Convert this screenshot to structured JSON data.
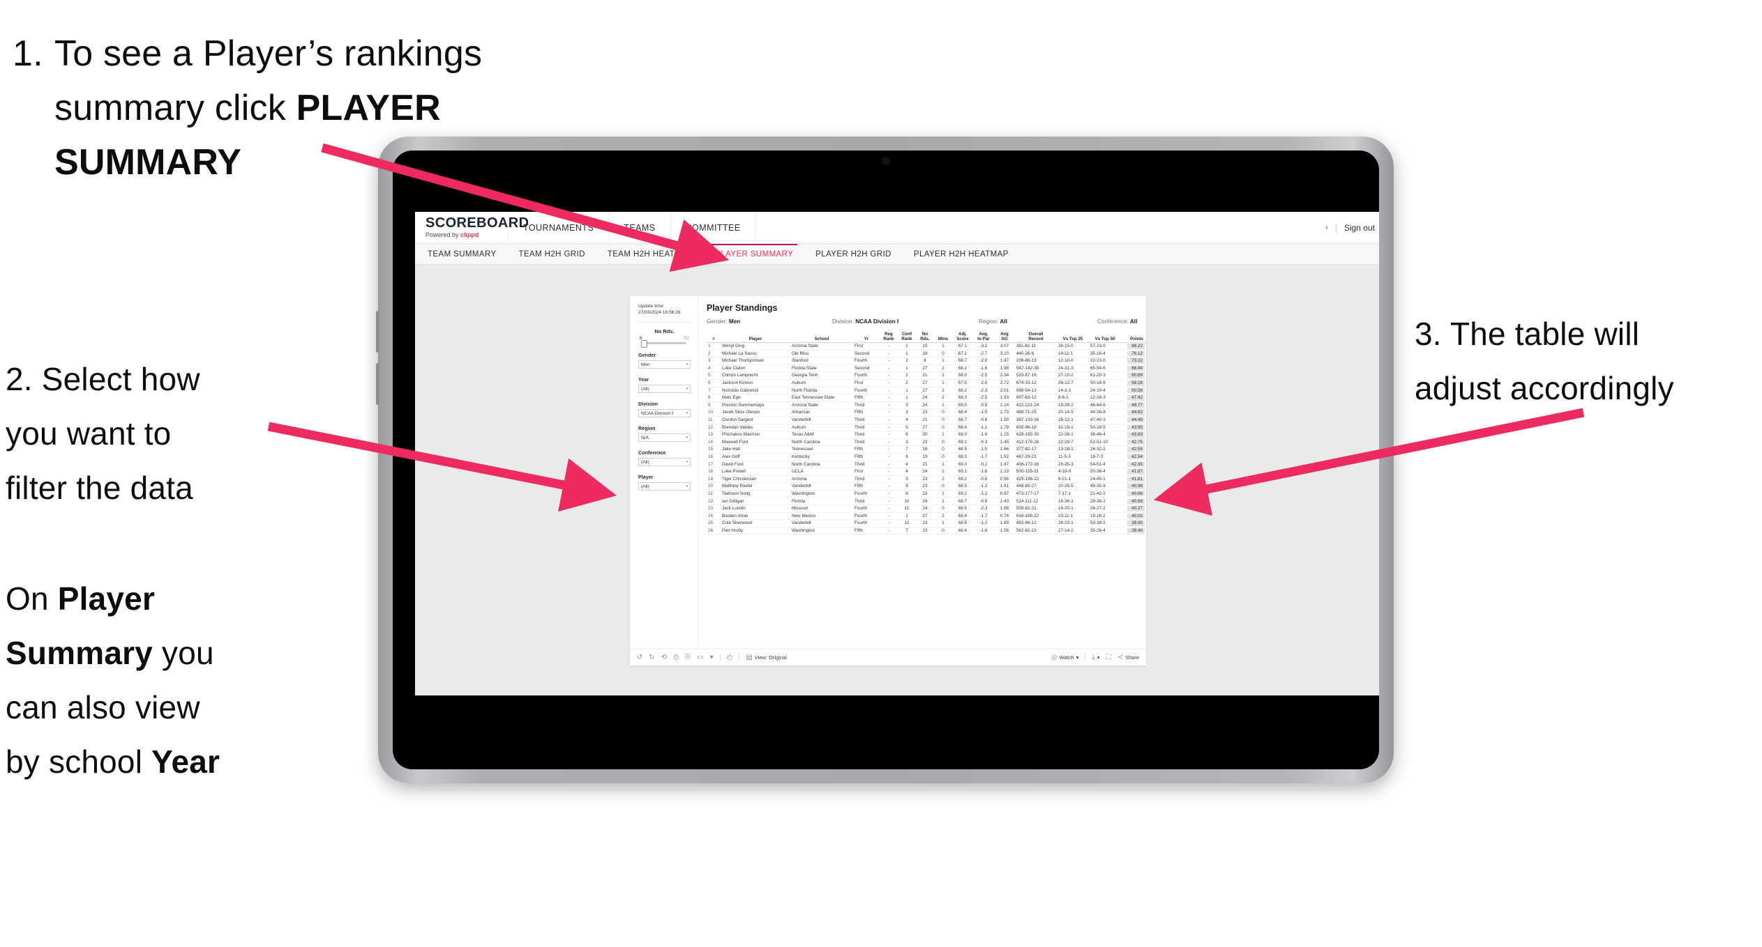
{
  "annotations": {
    "step1": {
      "num": "1.",
      "line1": "To see a Player’s rankings",
      "line2_pre": "summary click ",
      "line2_bold": "PLAYER",
      "line3_bold": "SUMMARY"
    },
    "step2": {
      "line1": "2. Select how",
      "line2": "you want to",
      "line3": "filter the data"
    },
    "step2b": {
      "l1_pre": "On ",
      "l1_bold": "Player",
      "l2_bold": "Summary",
      "l2_post": " you",
      "l3": "can also view",
      "l4_pre": "by school ",
      "l4_bold": "Year"
    },
    "step3": {
      "line1": "3. The table will",
      "line2": "adjust accordingly"
    }
  },
  "colors": {
    "accent": "#f2365b",
    "tab_underline": "#c2185b",
    "points_highlight": "#e2e2e2"
  },
  "app": {
    "logo": {
      "word": "SCOREBOARD",
      "powered_pre": "Powered by ",
      "powered_brand": "clippd"
    },
    "topnav": [
      "TOURNAMENTS",
      "TEAMS",
      "COMMITTEE"
    ],
    "account": {
      "chevron": "›",
      "divider": "|",
      "signout": "Sign out"
    },
    "tabs": [
      {
        "label": "TEAM SUMMARY",
        "active": false
      },
      {
        "label": "TEAM H2H GRID",
        "active": false
      },
      {
        "label": "TEAM H2H HEATMAP",
        "active": false
      },
      {
        "label": "PLAYER SUMMARY",
        "active": true
      },
      {
        "label": "PLAYER H2H GRID",
        "active": false
      },
      {
        "label": "PLAYER H2H HEATMAP",
        "active": false
      }
    ],
    "filters": {
      "update_label": "Update time:",
      "update_value": "27/03/2024 16:56:26",
      "slider": {
        "title": "No Rds.",
        "min": "6",
        "max": "52"
      },
      "selects": [
        {
          "label": "Gender",
          "value": "Men"
        },
        {
          "label": "Year",
          "value": "(All)"
        },
        {
          "label": "Division",
          "value": "NCAA Division I"
        },
        {
          "label": "Region",
          "value": "N/A"
        },
        {
          "label": "Conference",
          "value": "(All)"
        },
        {
          "label": "Player",
          "value": "(All)"
        }
      ]
    },
    "viz": {
      "title": "Player Standings",
      "subtitle": [
        {
          "label": "Gender:",
          "value": "Men"
        },
        {
          "label": "Division:",
          "value": "NCAA Division I"
        },
        {
          "label": "Region:",
          "value": "All"
        },
        {
          "label": "Conference:",
          "value": "All"
        }
      ],
      "columns": [
        {
          "key": "rank",
          "l1": "#",
          "l2": ""
        },
        {
          "key": "player",
          "l1": "Player",
          "l2": ""
        },
        {
          "key": "school",
          "l1": "School",
          "l2": ""
        },
        {
          "key": "yr",
          "l1": "Yr",
          "l2": ""
        },
        {
          "key": "reg",
          "l1": "Reg",
          "l2": "Rank"
        },
        {
          "key": "conf",
          "l1": "Conf",
          "l2": "Rank"
        },
        {
          "key": "nords",
          "l1": "No",
          "l2": "Rds."
        },
        {
          "key": "wins",
          "l1": "Wins",
          "l2": ""
        },
        {
          "key": "adj",
          "l1": "Adj.",
          "l2": "Score"
        },
        {
          "key": "avgpar",
          "l1": "Avg.",
          "l2": "to Par"
        },
        {
          "key": "sg",
          "l1": "Avg",
          "l2": "SG"
        },
        {
          "key": "record",
          "l1": "Overall",
          "l2": "Record"
        },
        {
          "key": "vs25",
          "l1": "Vs Top 25",
          "l2": ""
        },
        {
          "key": "vs50",
          "l1": "Vs Top 50",
          "l2": ""
        },
        {
          "key": "points",
          "l1": "Points",
          "l2": ""
        }
      ],
      "rows": [
        {
          "rank": "1",
          "player": "Wenyi Ding",
          "school": "Arizona State",
          "yr": "First",
          "reg": "-",
          "conf": "1",
          "nords": "15",
          "wins": "1",
          "adj": "67.1",
          "avgpar": "-3.2",
          "sg": "3.07",
          "record": "381-61-11",
          "vs25": "28-15-0",
          "vs50": "57-23-0",
          "points": "88.22"
        },
        {
          "rank": "2",
          "player": "Michael La Sasso",
          "school": "Ole Miss",
          "yr": "Second",
          "reg": "-",
          "conf": "1",
          "nords": "18",
          "wins": "0",
          "adj": "67.1",
          "avgpar": "-2.7",
          "sg": "3.10",
          "record": "440-26-6",
          "vs25": "19-11-1",
          "vs50": "35-16-4",
          "points": "76.12"
        },
        {
          "rank": "3",
          "player": "Michael Thorbjornsen",
          "school": "Stanford",
          "yr": "Fourth",
          "reg": "-",
          "conf": "2",
          "nords": "9",
          "wins": "1",
          "adj": "68.7",
          "avgpar": "-2.0",
          "sg": "1.47",
          "record": "208-86-13",
          "vs25": "12-10-0",
          "vs50": "22-22-0",
          "points": "73.22"
        },
        {
          "rank": "4",
          "player": "Luke Claton",
          "school": "Florida State",
          "yr": "Second",
          "reg": "-",
          "conf": "1",
          "nords": "27",
          "wins": "2",
          "adj": "68.2",
          "avgpar": "-1.6",
          "sg": "1.98",
          "record": "547-142-38",
          "vs25": "24-31-3",
          "vs50": "65-54-6",
          "points": "66.94"
        },
        {
          "rank": "5",
          "player": "Christo Lamprecht",
          "school": "Georgia Tech",
          "yr": "Fourth",
          "reg": "-",
          "conf": "2",
          "nords": "21",
          "wins": "2",
          "adj": "68.0",
          "avgpar": "-2.5",
          "sg": "2.34",
          "record": "533-57-16",
          "vs25": "27-10-2",
          "vs50": "61-20-3",
          "points": "60.89"
        },
        {
          "rank": "6",
          "player": "Jackson Koivun",
          "school": "Auburn",
          "yr": "First",
          "reg": "-",
          "conf": "2",
          "nords": "27",
          "wins": "1",
          "adj": "67.5",
          "avgpar": "-2.0",
          "sg": "2.72",
          "record": "674-33-12",
          "vs25": "28-12-7",
          "vs50": "50-16-8",
          "points": "58.18"
        },
        {
          "rank": "7",
          "player": "Nicholas Gabrelcik",
          "school": "North Florida",
          "yr": "Fourth",
          "reg": "-",
          "conf": "1",
          "nords": "27",
          "wins": "2",
          "adj": "68.2",
          "avgpar": "-2.3",
          "sg": "2.01",
          "record": "698-54-13",
          "vs25": "14-3-3",
          "vs50": "24-10-4",
          "points": "50.56"
        },
        {
          "rank": "8",
          "player": "Mats Ege",
          "school": "East Tennessee State",
          "yr": "Fifth",
          "reg": "-",
          "conf": "1",
          "nords": "24",
          "wins": "2",
          "adj": "68.3",
          "avgpar": "-2.5",
          "sg": "1.93",
          "record": "607-63-12",
          "vs25": "8-6-1",
          "vs50": "12-16-3",
          "points": "47.42"
        },
        {
          "rank": "9",
          "player": "Preston Summerhays",
          "school": "Arizona State",
          "yr": "Third",
          "reg": "-",
          "conf": "3",
          "nords": "24",
          "wins": "1",
          "adj": "69.0",
          "avgpar": "-0.5",
          "sg": "1.14",
          "record": "412-221-24",
          "vs25": "19-39-2",
          "vs50": "46-64-6",
          "points": "46.77"
        },
        {
          "rank": "10",
          "player": "Jacob Skov Olesen",
          "school": "Arkansas",
          "yr": "Fifth",
          "reg": "-",
          "conf": "3",
          "nords": "23",
          "wins": "0",
          "adj": "68.4",
          "avgpar": "-1.5",
          "sg": "1.73",
          "record": "488-72-25",
          "vs25": "20-14-5",
          "vs50": "44-26-8",
          "points": "44.82"
        },
        {
          "rank": "11",
          "player": "Gordon Sargent",
          "school": "Vanderbilt",
          "yr": "Third",
          "reg": "-",
          "conf": "4",
          "nords": "21",
          "wins": "0",
          "adj": "68.7",
          "avgpar": "-0.8",
          "sg": "1.50",
          "record": "387-133-16",
          "vs25": "25-22-1",
          "vs50": "47-40-3",
          "points": "44.49"
        },
        {
          "rank": "12",
          "player": "Brendan Valdes",
          "school": "Auburn",
          "yr": "Third",
          "reg": "-",
          "conf": "5",
          "nords": "27",
          "wins": "0",
          "adj": "68.4",
          "avgpar": "-1.1",
          "sg": "1.79",
          "record": "605-96-18",
          "vs25": "31-15-1",
          "vs50": "50-18-5",
          "points": "43.95"
        },
        {
          "rank": "13",
          "player": "Phichaksn Maichon",
          "school": "Texas A&M",
          "yr": "Third",
          "reg": "-",
          "conf": "6",
          "nords": "30",
          "wins": "1",
          "adj": "69.0",
          "avgpar": "-1.0",
          "sg": "1.15",
          "record": "628-192-30",
          "vs25": "22-26-1",
          "vs50": "38-46-4",
          "points": "43.83"
        },
        {
          "rank": "14",
          "player": "Maxwell Ford",
          "school": "North Carolina",
          "yr": "Third",
          "reg": "-",
          "conf": "3",
          "nords": "23",
          "wins": "0",
          "adj": "69.1",
          "avgpar": "-0.3",
          "sg": "1.45",
          "record": "412-178-28",
          "vs25": "22-29-7",
          "vs50": "52-51-10",
          "points": "42.75"
        },
        {
          "rank": "15",
          "player": "Jake Hall",
          "school": "Tennessee",
          "yr": "Fifth",
          "reg": "-",
          "conf": "7",
          "nords": "18",
          "wins": "0",
          "adj": "68.5",
          "avgpar": "-1.5",
          "sg": "1.66",
          "record": "377-82-17",
          "vs25": "13-18-1",
          "vs50": "26-32-2",
          "points": "42.55"
        },
        {
          "rank": "16",
          "player": "Alex Goff",
          "school": "Kentucky",
          "yr": "Fifth",
          "reg": "-",
          "conf": "8",
          "nords": "19",
          "wins": "0",
          "adj": "68.3",
          "avgpar": "-1.7",
          "sg": "1.92",
          "record": "467-29-23",
          "vs25": "11-5-3",
          "vs50": "18-7-3",
          "points": "42.54"
        },
        {
          "rank": "17",
          "player": "David Ford",
          "school": "North Carolina",
          "yr": "Third",
          "reg": "-",
          "conf": "4",
          "nords": "21",
          "wins": "1",
          "adj": "69.0",
          "avgpar": "-0.2",
          "sg": "1.47",
          "record": "406-172-16",
          "vs25": "26-25-3",
          "vs50": "54-51-4",
          "points": "42.35"
        },
        {
          "rank": "18",
          "player": "Luke Powell",
          "school": "UCLA",
          "yr": "First",
          "reg": "-",
          "conf": "4",
          "nords": "24",
          "wins": "1",
          "adj": "69.1",
          "avgpar": "-1.8",
          "sg": "1.13",
          "record": "500-155-31",
          "vs25": "4-18-0",
          "vs50": "20-36-4",
          "points": "41.87"
        },
        {
          "rank": "19",
          "player": "Tiger Christensen",
          "school": "Arizona",
          "yr": "Third",
          "reg": "-",
          "conf": "5",
          "nords": "23",
          "wins": "2",
          "adj": "69.2",
          "avgpar": "-0.6",
          "sg": "0.96",
          "record": "429-198-22",
          "vs25": "8-21-1",
          "vs50": "24-45-1",
          "points": "41.81"
        },
        {
          "rank": "20",
          "player": "Matthew Riedel",
          "school": "Vanderbilt",
          "yr": "Fifth",
          "reg": "-",
          "conf": "9",
          "nords": "23",
          "wins": "0",
          "adj": "68.5",
          "avgpar": "-1.2",
          "sg": "1.61",
          "record": "448-85-27",
          "vs25": "20-25-5",
          "vs50": "49-35-9",
          "points": "40.98"
        },
        {
          "rank": "21",
          "player": "Taehoon Song",
          "school": "Washington",
          "yr": "Fourth",
          "reg": "-",
          "conf": "6",
          "nords": "23",
          "wins": "1",
          "adj": "69.2",
          "avgpar": "-1.2",
          "sg": "0.87",
          "record": "473-177-17",
          "vs25": "7-17-1",
          "vs50": "21-42-2",
          "points": "40.88"
        },
        {
          "rank": "22",
          "player": "Ian Gilligan",
          "school": "Florida",
          "yr": "Third",
          "reg": "-",
          "conf": "10",
          "nords": "24",
          "wins": "1",
          "adj": "68.7",
          "avgpar": "-0.8",
          "sg": "1.43",
          "record": "514-111-12",
          "vs25": "14-26-1",
          "vs50": "29-38-2",
          "points": "40.68"
        },
        {
          "rank": "23",
          "player": "Jack Lundin",
          "school": "Missouri",
          "yr": "Fourth",
          "reg": "-",
          "conf": "11",
          "nords": "24",
          "wins": "0",
          "adj": "68.5",
          "avgpar": "-2.3",
          "sg": "1.68",
          "record": "509-82-21",
          "vs25": "14-20-1",
          "vs50": "26-27-2",
          "points": "40.27"
        },
        {
          "rank": "24",
          "player": "Bastien Amat",
          "school": "New Mexico",
          "yr": "Fourth",
          "reg": "-",
          "conf": "1",
          "nords": "27",
          "wins": "2",
          "adj": "69.4",
          "avgpar": "-1.7",
          "sg": "0.74",
          "record": "616-168-22",
          "vs25": "10-11-1",
          "vs50": "19-16-2",
          "points": "40.02"
        },
        {
          "rank": "25",
          "player": "Cole Sherwood",
          "school": "Vanderbilt",
          "yr": "Fourth",
          "reg": "-",
          "conf": "12",
          "nords": "23",
          "wins": "1",
          "adj": "68.5",
          "avgpar": "-1.2",
          "sg": "1.65",
          "record": "452-96-12",
          "vs25": "26-23-1",
          "vs50": "53-38-2",
          "points": "39.95"
        },
        {
          "rank": "26",
          "player": "Petr Hruby",
          "school": "Washington",
          "yr": "Fifth",
          "reg": "-",
          "conf": "7",
          "nords": "23",
          "wins": "0",
          "adj": "68.6",
          "avgpar": "-1.8",
          "sg": "1.56",
          "record": "562-82-23",
          "vs25": "17-14-2",
          "vs50": "35-26-4",
          "points": "39.49"
        }
      ]
    },
    "toolbar": {
      "left_icons": [
        "undo-icon",
        "redo-icon",
        "revert-icon",
        "refresh-icon",
        "pause-icon",
        "rect-select-icon",
        "caret-icon"
      ],
      "clock_icon": "clock-icon",
      "view_label": "View: Original",
      "watch_label": "Watch",
      "share_label": "Share"
    }
  }
}
